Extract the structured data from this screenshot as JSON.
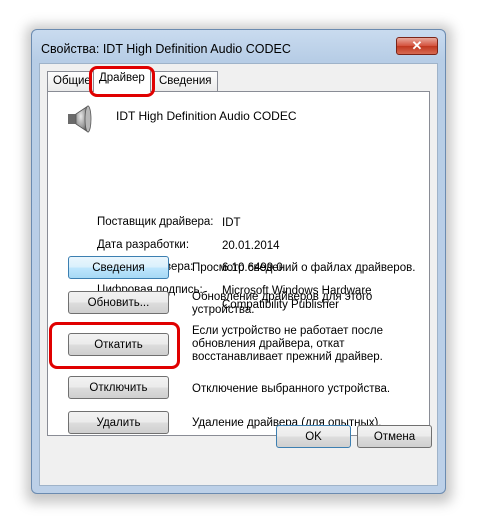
{
  "window": {
    "title": "Свойства: IDT High Definition Audio CODEC",
    "close_glyph": "✕"
  },
  "tabs": [
    {
      "label": "Общие"
    },
    {
      "label": "Драйвер"
    },
    {
      "label": "Сведения"
    }
  ],
  "device": {
    "name": "IDT High Definition Audio CODEC",
    "icon": "speaker-icon"
  },
  "properties": [
    {
      "label": "Поставщик драйвера:",
      "value": "IDT"
    },
    {
      "label": "Дата разработки:",
      "value": "20.01.2014"
    },
    {
      "label": "Версия драйвера:",
      "value": "6.10.6499.0"
    },
    {
      "label": "Цифровая подпись:",
      "value": "Microsoft Windows Hardware Compatibility Publisher"
    }
  ],
  "actions": [
    {
      "label": "Сведения",
      "description": "Просмотр сведений о файлах драйверов."
    },
    {
      "label": "Обновить...",
      "description": "Обновление драйверов для этого устройства."
    },
    {
      "label": "Откатить",
      "description": "Если устройство не работает после обновления драйвера, откат восстанавливает прежний драйвер."
    },
    {
      "label": "Отключить",
      "description": "Отключение выбранного устройства."
    },
    {
      "label": "Удалить",
      "description": "Удаление драйвера (для опытных)."
    }
  ],
  "footer": {
    "ok": "OK",
    "cancel": "Отмена"
  },
  "colors": {
    "highlight": "#e00000",
    "title_bar": "#c9dbef",
    "close_button": "#c0371f"
  }
}
